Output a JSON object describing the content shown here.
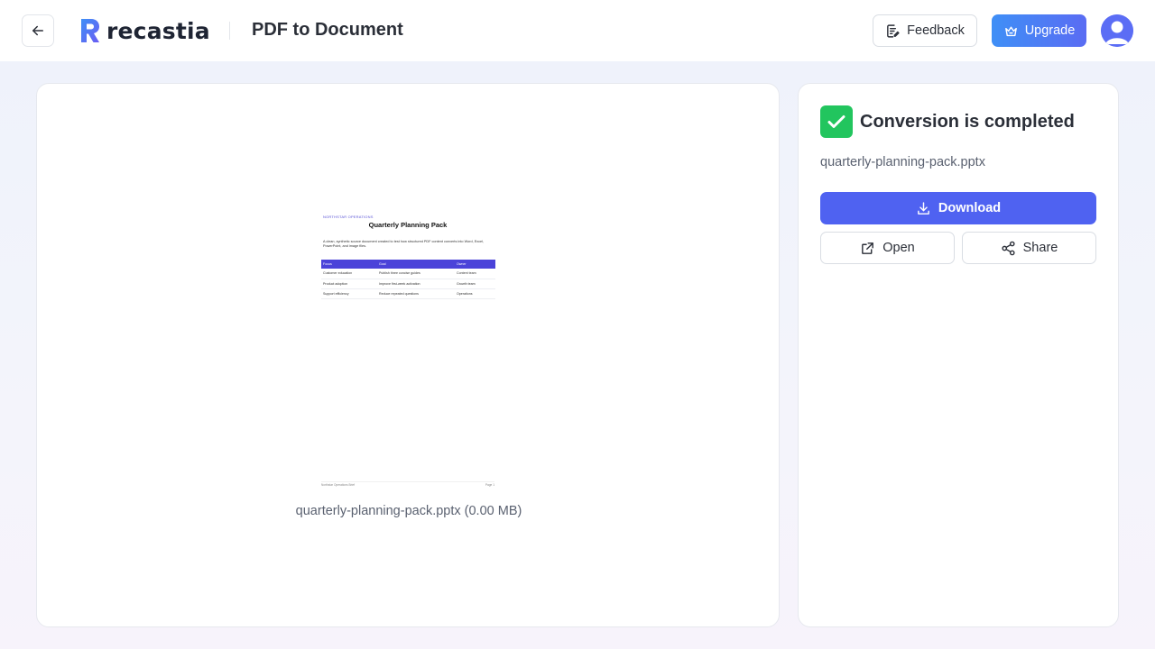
{
  "header": {
    "back_icon": "arrow-left-icon",
    "logo_text": "recastia",
    "page_title": "PDF to Document",
    "feedback_label": "Feedback",
    "feedback_icon": "edit-note-icon",
    "upgrade_label": "Upgrade",
    "upgrade_icon": "crown-icon",
    "avatar_icon": "user-avatar-icon"
  },
  "preview": {
    "document": {
      "org": "NORTHSTAR OPERATIONS",
      "title": "Quarterly Planning Pack",
      "intro": "A clean, synthetic source document created to test how structured PDF content converts into Word, Excel, PowerPoint, and image files.",
      "table": {
        "headers": [
          "Focus",
          "Goal",
          "Owner"
        ],
        "rows": [
          [
            "Customer education",
            "Publish three concise guides",
            "Content team"
          ],
          [
            "Product adoption",
            "Improve first-week activation",
            "Growth team"
          ],
          [
            "Support efficiency",
            "Reduce repeated questions",
            "Operations"
          ]
        ]
      },
      "footer_left": "Northstar Operations Brief",
      "footer_right": "Page 1"
    },
    "caption": "quarterly-planning-pack.pptx (0.00 MB)"
  },
  "result": {
    "status_icon": "check-icon",
    "status_color": "#22c55e",
    "title": "Conversion is completed",
    "filename": "quarterly-planning-pack.pptx",
    "download_label": "Download",
    "download_icon": "download-icon",
    "open_label": "Open",
    "open_icon": "external-link-icon",
    "share_label": "Share",
    "share_icon": "share-icon"
  },
  "colors": {
    "accent": "#4f62f1",
    "upgrade_gradient_start": "#3f8ff6",
    "upgrade_gradient_end": "#5a6cf3",
    "success": "#22c55e"
  }
}
